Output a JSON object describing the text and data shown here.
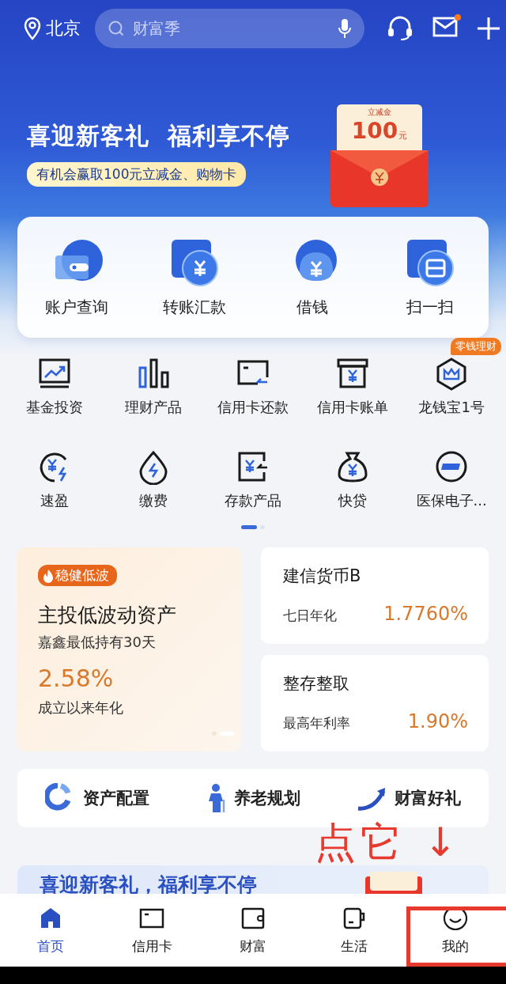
{
  "location": "北京",
  "search": {
    "placeholder": "财富季"
  },
  "mail": {
    "unread": true
  },
  "hero": {
    "title": "喜迎新客礼  福利享不停",
    "subtitle": "有机会赢取100元立减金、购物卡",
    "envelope": {
      "label": "立减金",
      "amount": "100",
      "unit": "元"
    }
  },
  "quick_actions": [
    {
      "label": "账户查询"
    },
    {
      "label": "转账汇款"
    },
    {
      "label": "借钱"
    },
    {
      "label": "扫一扫"
    }
  ],
  "services": [
    {
      "label": "基金投资"
    },
    {
      "label": "理财产品"
    },
    {
      "label": "信用卡还款"
    },
    {
      "label": "信用卡账单"
    },
    {
      "label": "龙钱宝1号",
      "tag": "零钱理财"
    },
    {
      "label": "速盈"
    },
    {
      "label": "缴费"
    },
    {
      "label": "存款产品"
    },
    {
      "label": "快贷"
    },
    {
      "label": "医保电子..."
    }
  ],
  "services_pager": [
    {
      "selected": true
    },
    {
      "selected": false
    }
  ],
  "featured": {
    "tag": "稳健低波",
    "title": "主投低波动资产",
    "subtitle": "嘉鑫最低持有30天",
    "rate": "2.58%",
    "rate_label": "成立以来年化",
    "pager": [
      {
        "selected": false
      },
      {
        "selected": true
      }
    ]
  },
  "products": [
    {
      "name": "建信货币B",
      "rate_label": "七日年化",
      "rate": "1.7760%"
    },
    {
      "name": "整存整取",
      "rate_label": "最高年利率",
      "rate": "1.90%"
    }
  ],
  "shortcuts": [
    {
      "label": "资产配置"
    },
    {
      "label": "养老规划"
    },
    {
      "label": "财富好礼"
    }
  ],
  "promo_banner": {
    "title": "喜迎新客礼，福利享不停"
  },
  "annotation": {
    "text": "点它",
    "arrow": "↓"
  },
  "tabs": [
    {
      "label": "首页",
      "selected": true,
      "highlighted": false
    },
    {
      "label": "信用卡",
      "selected": false,
      "highlighted": false
    },
    {
      "label": "财富",
      "selected": false,
      "highlighted": false
    },
    {
      "label": "生活",
      "selected": false,
      "highlighted": false
    },
    {
      "label": "我的",
      "selected": false,
      "highlighted": true
    }
  ]
}
